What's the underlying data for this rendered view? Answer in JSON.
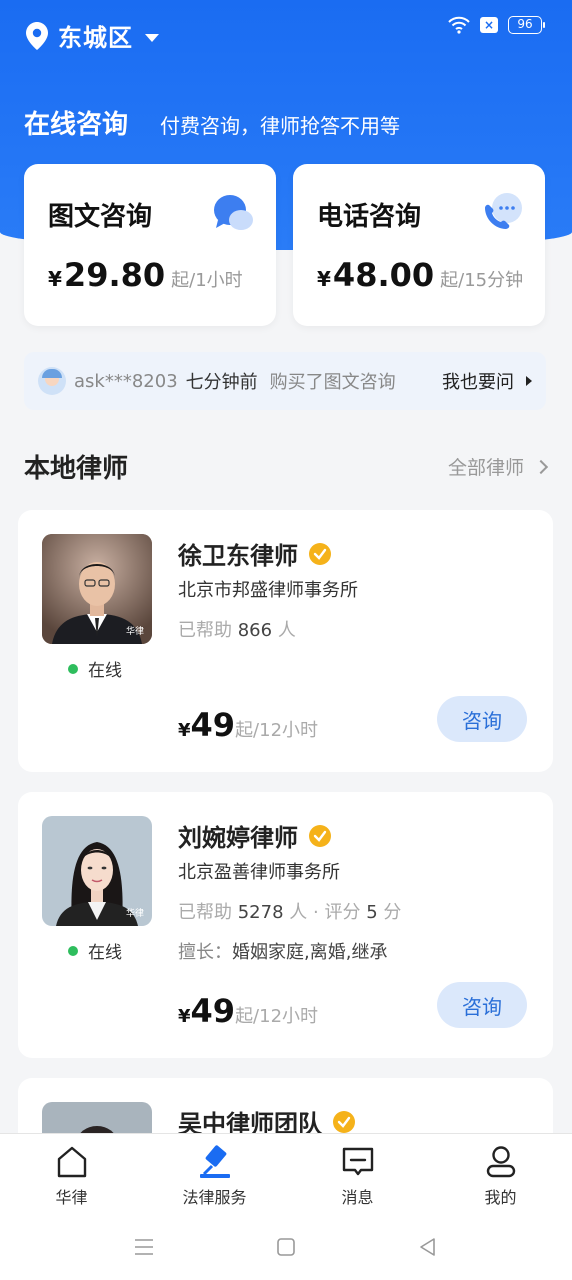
{
  "status": {
    "location": "东城区",
    "battery": "96"
  },
  "hero": {
    "title": "在线咨询",
    "subtitle": "付费咨询，律师抢答不用等"
  },
  "consult": [
    {
      "title": "图文咨询",
      "yen": "¥",
      "amount": "29.80",
      "unit": "起/1小时",
      "icon": "chat-bubble-icon"
    },
    {
      "title": "电话咨询",
      "yen": "¥",
      "amount": "48.00",
      "unit": "起/15分钟",
      "icon": "phone-icon"
    }
  ],
  "ticker": {
    "user": "ask***8203",
    "time": "七分钟前",
    "action": "购买了图文咨询",
    "ask": "我也要问"
  },
  "section": {
    "title": "本地律师",
    "more": "全部律师"
  },
  "lawyers": [
    {
      "name": "徐卫东律师",
      "firm": "北京市邦盛律师事务所",
      "helped_label": "已帮助",
      "helped": "866",
      "helped_unit": "人",
      "status": "在线",
      "yen": "¥",
      "price": "49",
      "unit": "起/12小时",
      "button": "咨询",
      "watermark": "华律"
    },
    {
      "name": "刘婉婷律师",
      "firm": "北京盈善律师事务所",
      "helped_label": "已帮助",
      "helped": "5278",
      "helped_unit": "人 · 评分",
      "rating": "5",
      "rating_unit": "分",
      "skill_label": "擅长：",
      "skill": "婚姻家庭,离婚,继承",
      "status": "在线",
      "yen": "¥",
      "price": "49",
      "unit": "起/12小时",
      "button": "咨询",
      "watermark": "华律"
    },
    {
      "name": "吴中律师团队"
    }
  ],
  "tabs": [
    {
      "label": "华律",
      "icon": "home-icon"
    },
    {
      "label": "法律服务",
      "icon": "gavel-icon"
    },
    {
      "label": "消息",
      "icon": "message-icon"
    },
    {
      "label": "我的",
      "icon": "user-icon"
    }
  ]
}
